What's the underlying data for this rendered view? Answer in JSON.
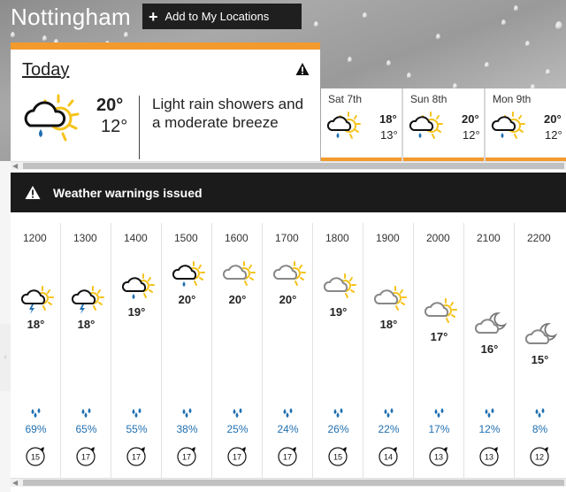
{
  "location": {
    "name": "Nottingham",
    "add_label": "Add to My Locations"
  },
  "today": {
    "label": "Today",
    "high": "20°",
    "low": "12°",
    "description": "Light rain showers and a moderate breeze",
    "icon": "light-rain-showers-icon",
    "warning_icon": "warning-triangle-icon"
  },
  "days": [
    {
      "name": "Sat 7th",
      "high": "18°",
      "low": "13°",
      "icon": "light-rain-showers-icon"
    },
    {
      "name": "Sun 8th",
      "high": "20°",
      "low": "12°",
      "icon": "light-rain-showers-icon"
    },
    {
      "name": "Mon 9th",
      "high": "20°",
      "low": "12°",
      "icon": "light-rain-showers-icon"
    }
  ],
  "warnings": {
    "label": "Weather warnings issued"
  },
  "hours": [
    {
      "time": "1200",
      "temp": "18°",
      "rain": "69%",
      "wind": "15",
      "icon": "thundery-showers-icon"
    },
    {
      "time": "1300",
      "temp": "18°",
      "rain": "65%",
      "wind": "17",
      "icon": "thundery-showers-icon"
    },
    {
      "time": "1400",
      "temp": "19°",
      "rain": "55%",
      "wind": "17",
      "icon": "light-rain-showers-icon"
    },
    {
      "time": "1500",
      "temp": "20°",
      "rain": "38%",
      "wind": "17",
      "icon": "light-rain-showers-icon"
    },
    {
      "time": "1600",
      "temp": "20°",
      "rain": "25%",
      "wind": "17",
      "icon": "sunny-intervals-icon"
    },
    {
      "time": "1700",
      "temp": "20°",
      "rain": "24%",
      "wind": "17",
      "icon": "sunny-intervals-icon"
    },
    {
      "time": "1800",
      "temp": "19°",
      "rain": "26%",
      "wind": "15",
      "icon": "sunny-intervals-icon"
    },
    {
      "time": "1900",
      "temp": "18°",
      "rain": "22%",
      "wind": "14",
      "icon": "sunny-intervals-icon"
    },
    {
      "time": "2000",
      "temp": "17°",
      "rain": "17%",
      "wind": "13",
      "icon": "sunny-intervals-icon"
    },
    {
      "time": "2100",
      "temp": "16°",
      "rain": "12%",
      "wind": "13",
      "icon": "partly-cloudy-night-icon"
    },
    {
      "time": "2200",
      "temp": "15°",
      "rain": "8%",
      "wind": "12",
      "icon": "partly-cloudy-night-icon"
    }
  ],
  "colors": {
    "accent": "#f39a2d",
    "rain_blue": "#1f6fb0",
    "sun": "#f6c31b",
    "dark_bar": "#1b1b1b"
  }
}
